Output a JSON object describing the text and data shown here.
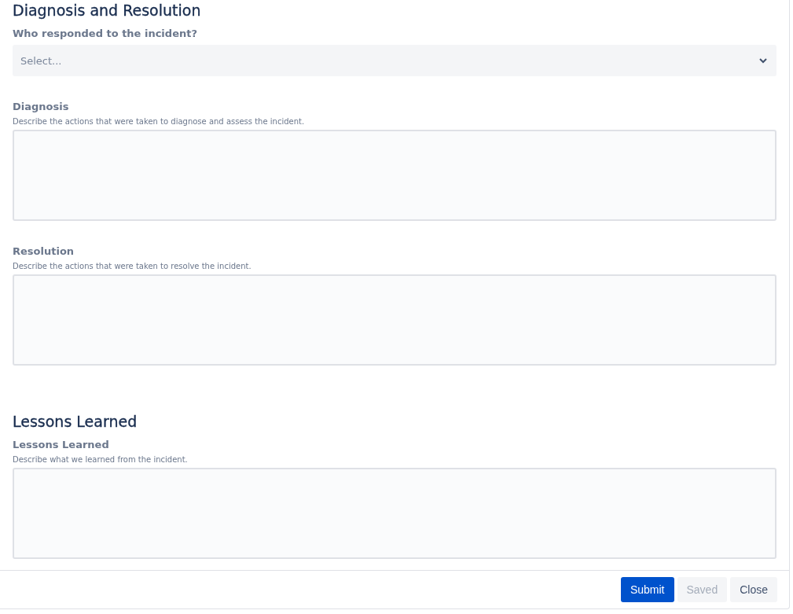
{
  "sections": [
    {
      "title": "Diagnosis and Resolution",
      "fields": [
        {
          "kind": "select",
          "label": "Who responded to the incident?",
          "placeholder": "Select..."
        },
        {
          "kind": "textarea",
          "label": "Diagnosis",
          "description": "Describe the actions that were taken to diagnose and assess the incident."
        },
        {
          "kind": "textarea",
          "label": "Resolution",
          "description": "Describe the actions that were taken to resolve the incident."
        }
      ]
    },
    {
      "title": "Lessons Learned",
      "fields": [
        {
          "kind": "textarea",
          "label": "Lessons Learned",
          "description": "Describe what we learned from the incident."
        }
      ]
    }
  ],
  "buttons": [
    {
      "label": "Submit",
      "kind": "primary",
      "disabled": false
    },
    {
      "label": "Saved",
      "kind": "secondary",
      "disabled": true
    },
    {
      "label": "Close",
      "kind": "secondary",
      "disabled": false
    }
  ]
}
